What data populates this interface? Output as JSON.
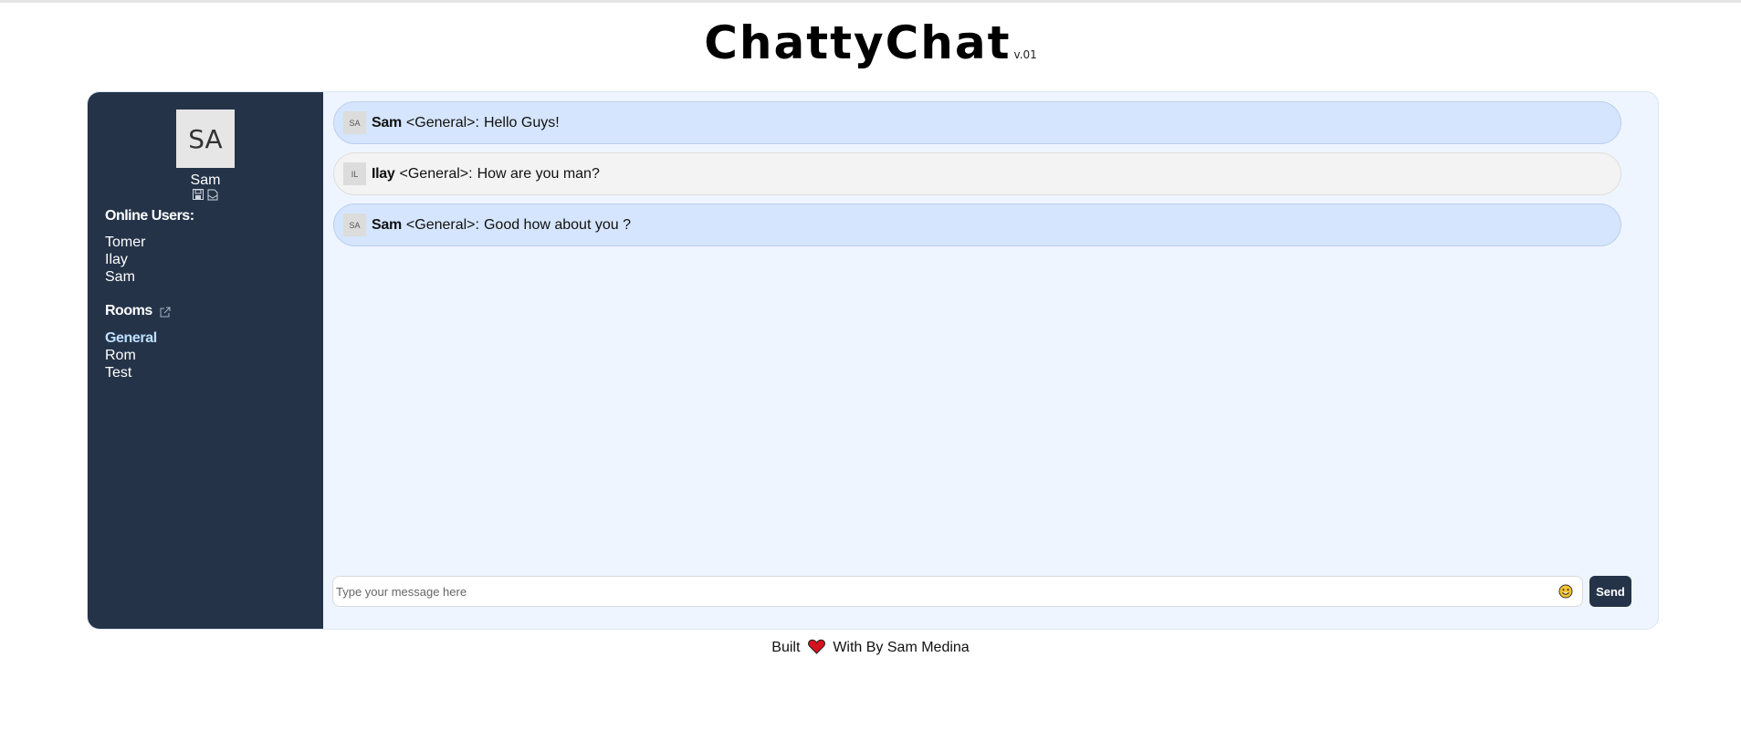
{
  "header": {
    "title": "ChattyChat",
    "version": "v.01"
  },
  "profile": {
    "initials": "SA",
    "name": "Sam",
    "icons": [
      "save-icon",
      "inbox-icon"
    ]
  },
  "online_users": {
    "title": "Online Users:",
    "users": [
      "Tomer",
      "Ilay",
      "Sam"
    ]
  },
  "rooms": {
    "title": "Rooms",
    "icon": "external-link-icon",
    "items": [
      "General",
      "Rom",
      "Test"
    ],
    "active": "General"
  },
  "messages": [
    {
      "initials": "SA",
      "user": "Sam",
      "room": "<General>:",
      "text": "Hello Guys!",
      "own": true
    },
    {
      "initials": "IL",
      "user": "Ilay",
      "room": "<General>:",
      "text": "How are you man?",
      "own": false
    },
    {
      "initials": "SA",
      "user": "Sam",
      "room": "<General>:",
      "text": "Good how about you ?",
      "own": true
    }
  ],
  "composer": {
    "placeholder": "Type your message here",
    "emoji_icon": "smiley-icon",
    "send_label": "Send"
  },
  "footer": {
    "built": "Built",
    "rest": "With By Sam Medina",
    "icon": "heart-icon"
  },
  "colors": {
    "sidebar": "#243348",
    "own_message": "#d5e5fd",
    "other_message": "#f3f3f3",
    "chat_bg": "#eff5fe",
    "active_room": "#bde0ff",
    "heart": "#d6121e"
  }
}
